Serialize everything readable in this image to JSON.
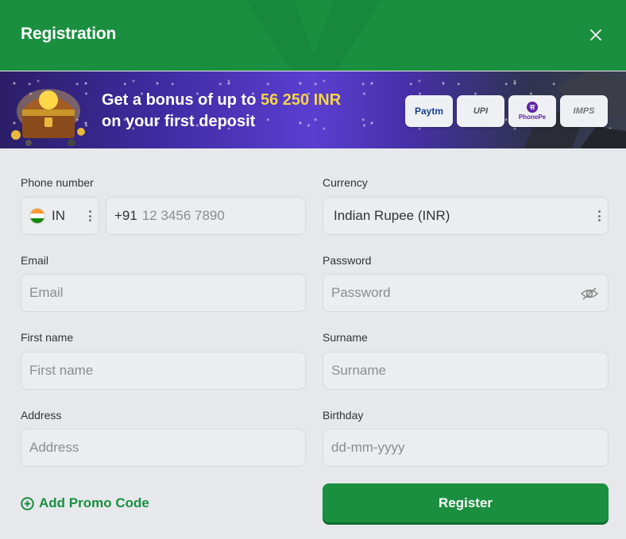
{
  "header": {
    "title": "Registration"
  },
  "banner": {
    "text_prefix": "Get a bonus of up to ",
    "amount": "56 250 INR",
    "text_line2": "on your first deposit",
    "payment_methods": [
      "Paytm",
      "UPI",
      "PhonePe",
      "IMPS"
    ]
  },
  "form": {
    "phone": {
      "label": "Phone number",
      "country_code": "IN",
      "dial_code": "+91",
      "placeholder": "12 3456 7890"
    },
    "currency": {
      "label": "Currency",
      "value": "Indian Rupee (INR)"
    },
    "email": {
      "label": "Email",
      "placeholder": "Email"
    },
    "password": {
      "label": "Password",
      "placeholder": "Password"
    },
    "first_name": {
      "label": "First name",
      "placeholder": "First name"
    },
    "surname": {
      "label": "Surname",
      "placeholder": "Surname"
    },
    "address": {
      "label": "Address",
      "placeholder": "Address"
    },
    "birthday": {
      "label": "Birthday",
      "placeholder": "dd-mm-yyyy"
    }
  },
  "actions": {
    "promo_label": "Add Promo Code",
    "register_label": "Register"
  },
  "colors": {
    "brand_green": "#1a8f40",
    "bonus_yellow": "#f5d547",
    "background": "#e6e8ec"
  }
}
